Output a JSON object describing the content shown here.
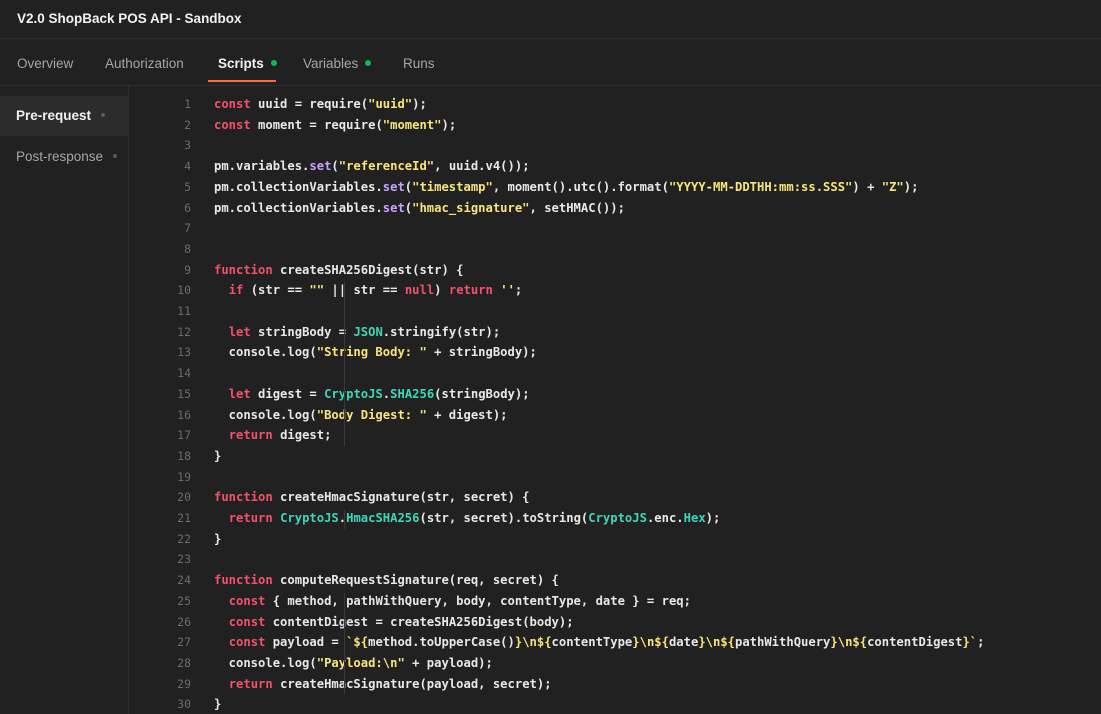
{
  "window": {
    "title": "V2.0 ShopBack POS API - Sandbox"
  },
  "tabs": [
    {
      "label": "Overview",
      "dot": false
    },
    {
      "label": "Authorization",
      "dot": false
    },
    {
      "label": "Scripts",
      "dot": true
    },
    {
      "label": "Variables",
      "dot": true
    },
    {
      "label": "Runs",
      "dot": false
    }
  ],
  "active_tab": "Scripts",
  "sidebar": {
    "items": [
      {
        "label": "Pre-request"
      },
      {
        "label": "Post-response"
      }
    ],
    "active": "Pre-request"
  },
  "colors": {
    "accent": "#ff6c37",
    "status_dot": "#0cbb52",
    "keyword": "#f2526a",
    "string": "#f7e57c",
    "method": "#c9a2ff",
    "builtin": "#3fd6b8"
  },
  "editor": {
    "lines": [
      [
        [
          "kw",
          "const "
        ],
        [
          "p",
          "uuid = "
        ],
        [
          "p",
          "require("
        ],
        [
          "str",
          "\"uuid\""
        ],
        [
          "p",
          ");"
        ]
      ],
      [
        [
          "kw",
          "const "
        ],
        [
          "p",
          "moment = "
        ],
        [
          "p",
          "require("
        ],
        [
          "str",
          "\"moment\""
        ],
        [
          "p",
          ");"
        ]
      ],
      [],
      [
        [
          "p",
          "pm.variables."
        ],
        [
          "fn",
          "set"
        ],
        [
          "p",
          "("
        ],
        [
          "str",
          "\"referenceId\""
        ],
        [
          "p",
          ", uuid.v4());"
        ]
      ],
      [
        [
          "p",
          "pm.collectionVariables."
        ],
        [
          "fn",
          "set"
        ],
        [
          "p",
          "("
        ],
        [
          "str",
          "\"timestamp\""
        ],
        [
          "p",
          ", moment().utc().format("
        ],
        [
          "str",
          "\"YYYY-MM-DDTHH:mm:ss.SSS\""
        ],
        [
          "p",
          ") + "
        ],
        [
          "str",
          "\"Z\""
        ],
        [
          "p",
          ");"
        ]
      ],
      [
        [
          "p",
          "pm.collectionVariables."
        ],
        [
          "fn",
          "set"
        ],
        [
          "p",
          "("
        ],
        [
          "str",
          "\"hmac_signature\""
        ],
        [
          "p",
          ", setHMAC());"
        ]
      ],
      [],
      [],
      [
        [
          "kw",
          "function "
        ],
        [
          "p",
          "createSHA256Digest(str) {"
        ]
      ],
      [
        [
          "p",
          "  "
        ],
        [
          "kw",
          "if "
        ],
        [
          "p",
          "(str == "
        ],
        [
          "str",
          "\"\""
        ],
        [
          "p",
          " || str == "
        ],
        [
          "kw",
          "null"
        ],
        [
          "p",
          ") "
        ],
        [
          "kw",
          "return "
        ],
        [
          "str",
          "''"
        ],
        [
          "p",
          ";"
        ]
      ],
      [],
      [
        [
          "p",
          "  "
        ],
        [
          "kw",
          "let "
        ],
        [
          "p",
          "stringBody = "
        ],
        [
          "obj",
          "JSON"
        ],
        [
          "p",
          ".stringify(str);"
        ]
      ],
      [
        [
          "p",
          "  console.log("
        ],
        [
          "str",
          "\"String Body: \""
        ],
        [
          "p",
          " + stringBody);"
        ]
      ],
      [],
      [
        [
          "p",
          "  "
        ],
        [
          "kw",
          "let "
        ],
        [
          "p",
          "digest = "
        ],
        [
          "obj",
          "CryptoJS"
        ],
        [
          "p",
          "."
        ],
        [
          "obj",
          "SHA256"
        ],
        [
          "p",
          "(stringBody);"
        ]
      ],
      [
        [
          "p",
          "  console.log("
        ],
        [
          "str",
          "\"Body Digest: \""
        ],
        [
          "p",
          " + digest);"
        ]
      ],
      [
        [
          "p",
          "  "
        ],
        [
          "kw",
          "return "
        ],
        [
          "p",
          "digest;"
        ]
      ],
      [
        [
          "p",
          "}"
        ]
      ],
      [],
      [
        [
          "kw",
          "function "
        ],
        [
          "p",
          "createHmacSignature(str, secret) {"
        ]
      ],
      [
        [
          "p",
          "  "
        ],
        [
          "kw",
          "return "
        ],
        [
          "obj",
          "CryptoJS"
        ],
        [
          "p",
          "."
        ],
        [
          "obj",
          "HmacSHA256"
        ],
        [
          "p",
          "(str, secret).toString("
        ],
        [
          "obj",
          "CryptoJS"
        ],
        [
          "p",
          ".enc."
        ],
        [
          "obj",
          "Hex"
        ],
        [
          "p",
          ");"
        ]
      ],
      [
        [
          "p",
          "}"
        ]
      ],
      [],
      [
        [
          "kw",
          "function "
        ],
        [
          "p",
          "computeRequestSignature(req, secret) {"
        ]
      ],
      [
        [
          "p",
          "  "
        ],
        [
          "kw",
          "const "
        ],
        [
          "p",
          "{ method, pathWithQuery, body, contentType, date } = req;"
        ]
      ],
      [
        [
          "p",
          "  "
        ],
        [
          "kw",
          "const "
        ],
        [
          "p",
          "contentDigest = createSHA256Digest(body);"
        ]
      ],
      [
        [
          "p",
          "  "
        ],
        [
          "kw",
          "const "
        ],
        [
          "p",
          "payload = "
        ],
        [
          "str",
          "`${"
        ],
        [
          "p",
          "method.toUpperCase()"
        ],
        [
          "str",
          "}\\n${"
        ],
        [
          "p",
          "contentType"
        ],
        [
          "str",
          "}\\n${"
        ],
        [
          "p",
          "date"
        ],
        [
          "str",
          "}\\n${"
        ],
        [
          "p",
          "pathWithQuery"
        ],
        [
          "str",
          "}\\n${"
        ],
        [
          "p",
          "contentDigest"
        ],
        [
          "str",
          "}`"
        ],
        [
          "p",
          ";"
        ]
      ],
      [
        [
          "p",
          "  console.log("
        ],
        [
          "str",
          "\"Payload:\\n\""
        ],
        [
          "p",
          " + payload);"
        ]
      ],
      [
        [
          "p",
          "  "
        ],
        [
          "kw",
          "return "
        ],
        [
          "p",
          "createHmacSignature(payload, secret);"
        ]
      ],
      [
        [
          "p",
          "}"
        ]
      ]
    ]
  }
}
